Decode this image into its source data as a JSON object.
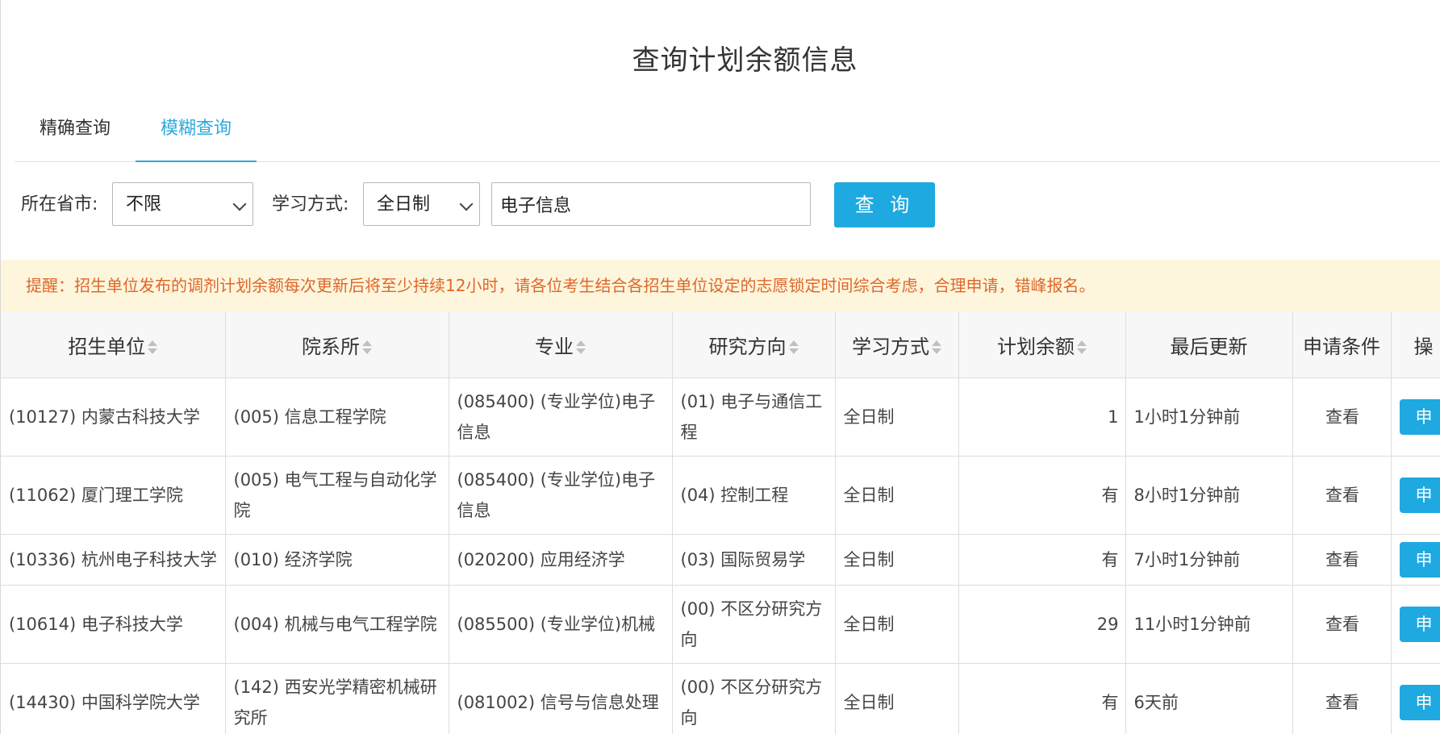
{
  "page": {
    "title": "查询计划余额信息"
  },
  "tabs": [
    {
      "label": "精确查询"
    },
    {
      "label": "模糊查询"
    }
  ],
  "filters": {
    "province_label": "所在省市:",
    "province_value": "不限",
    "study_label": "学习方式:",
    "study_value": "全日制",
    "keyword_value": "电子信息",
    "query_button": "查 询"
  },
  "notice": "提醒：招生单位发布的调剂计划余额每次更新后将至少持续12小时，请各位考生结合各招生单位设定的志愿锁定时间综合考虑，合理申请，错峰报名。",
  "table": {
    "headers": [
      "招生单位",
      "院系所",
      "专业",
      "研究方向",
      "学习方式",
      "计划余额",
      "最后更新",
      "申请条件",
      "操"
    ],
    "rows": [
      {
        "unit": "(10127) 内蒙古科技大学",
        "dept": "(005) 信息工程学院",
        "major": "(085400) (专业学位)电子信息",
        "direction": "(01) 电子与通信工程",
        "mode": "全日制",
        "remaining": "1",
        "updated": "1小时1分钟前",
        "conditions": "查看",
        "action": "申"
      },
      {
        "unit": "(11062) 厦门理工学院",
        "dept": "(005) 电气工程与自动化学院",
        "major": "(085400) (专业学位)电子信息",
        "direction": "(04) 控制工程",
        "mode": "全日制",
        "remaining": "有",
        "updated": "8小时1分钟前",
        "conditions": "查看",
        "action": "申"
      },
      {
        "unit": "(10336) 杭州电子科技大学",
        "dept": "(010) 经济学院",
        "major": "(020200) 应用经济学",
        "direction": "(03) 国际贸易学",
        "mode": "全日制",
        "remaining": "有",
        "updated": "7小时1分钟前",
        "conditions": "查看",
        "action": "申"
      },
      {
        "unit": "(10614) 电子科技大学",
        "dept": "(004) 机械与电气工程学院",
        "major": "(085500) (专业学位)机械",
        "direction": "(00) 不区分研究方向",
        "mode": "全日制",
        "remaining": "29",
        "updated": "11小时1分钟前",
        "conditions": "查看",
        "action": "申"
      },
      {
        "unit": "(14430) 中国科学院大学",
        "dept": "(142) 西安光学精密机械研究所",
        "major": "(081002) 信号与信息处理",
        "direction": "(00) 不区分研究方向",
        "mode": "全日制",
        "remaining": "有",
        "updated": "6天前",
        "conditions": "查看",
        "action": "申"
      }
    ]
  },
  "colors": {
    "accent": "#1ea9e1",
    "link": "#1e9fd8",
    "notice_bg": "#fdf6dc",
    "notice_text": "#e0662b"
  }
}
